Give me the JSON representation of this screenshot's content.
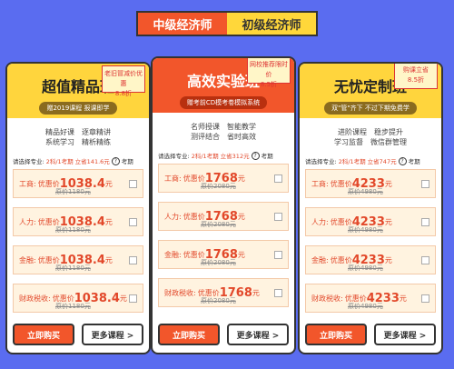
{
  "tabs": [
    {
      "label": "中级经济师",
      "active": true
    },
    {
      "label": "初级经济师",
      "active": false
    }
  ],
  "cards": [
    {
      "title": "超值精品班",
      "subtitle": "赠2019课程 报课即学",
      "discount_line1": "老旧冒减价优惠",
      "discount_line2": "8.8折",
      "features": [
        [
          "精品好课",
          "逐章精讲"
        ],
        [
          "系统学习",
          "精析精练"
        ]
      ],
      "selector": {
        "prefix": "请选择专业:",
        "count": "2科/1考期",
        "total": "立省141.6元",
        "suffix": "考期"
      },
      "items": [
        {
          "name": "工商:",
          "price_label": "优惠价",
          "price": "1038.4",
          "unit": "元",
          "orig": "原价1180元"
        },
        {
          "name": "人力:",
          "price_label": "优惠价",
          "price": "1038.4",
          "unit": "元",
          "orig": "原价1180元"
        },
        {
          "name": "金融:",
          "price_label": "优惠价",
          "price": "1038.4",
          "unit": "元",
          "orig": "原价1180元"
        },
        {
          "name": "财政税收:",
          "price_label": "优惠价",
          "price": "1038.4",
          "unit": "元",
          "orig": "原价1180元"
        }
      ],
      "buy": "立即购买",
      "more": "更多课程 >"
    },
    {
      "title": "高效实验班",
      "subtitle": "赠考前CD模考卷模拟系统",
      "discount_line1": "网校推荐限时价",
      "discount_line2": "8.5折",
      "features": [
        [
          "名师授课",
          "智能教学"
        ],
        [
          "测评结合",
          "省时高效"
        ]
      ],
      "selector": {
        "prefix": "请选择专业:",
        "count": "2科/1考期",
        "total": "立省312元",
        "suffix": "考期"
      },
      "items": [
        {
          "name": "工商:",
          "price_label": "优惠价",
          "price": "1768",
          "unit": "元",
          "orig": "原价2080元"
        },
        {
          "name": "人力:",
          "price_label": "优惠价",
          "price": "1768",
          "unit": "元",
          "orig": "原价2080元"
        },
        {
          "name": "金融:",
          "price_label": "优惠价",
          "price": "1768",
          "unit": "元",
          "orig": "原价2080元"
        },
        {
          "name": "财政税收:",
          "price_label": "优惠价",
          "price": "1768",
          "unit": "元",
          "orig": "原价2080元"
        }
      ],
      "buy": "立即购买",
      "more": "更多课程 >"
    },
    {
      "title": "无忧定制班",
      "subtitle": "双\"管\"齐下 不过下期免费学",
      "discount_line1": "购课立省",
      "discount_line2": "8.5折",
      "features": [
        [
          "进阶课程",
          "稳步提升"
        ],
        [
          "学习监督",
          "微信群管理"
        ]
      ],
      "selector": {
        "prefix": "请选择专业:",
        "count": "2科/1考期",
        "total": "立省747元",
        "suffix": "考期"
      },
      "items": [
        {
          "name": "工商:",
          "price_label": "优惠价",
          "price": "4233",
          "unit": "元",
          "orig": "原价4980元"
        },
        {
          "name": "人力:",
          "price_label": "优惠价",
          "price": "4233",
          "unit": "元",
          "orig": "原价4980元"
        },
        {
          "name": "金融:",
          "price_label": "优惠价",
          "price": "4233",
          "unit": "元",
          "orig": "原价4980元"
        },
        {
          "name": "财政税收:",
          "price_label": "优惠价",
          "price": "4233",
          "unit": "元",
          "orig": "原价4980元"
        }
      ],
      "buy": "立即购买",
      "more": "更多课程 >"
    }
  ],
  "colors": {
    "background": "#5a6cf0",
    "accent": "#f2562b",
    "yellow": "#ffd53d",
    "price": "#e2482a"
  }
}
